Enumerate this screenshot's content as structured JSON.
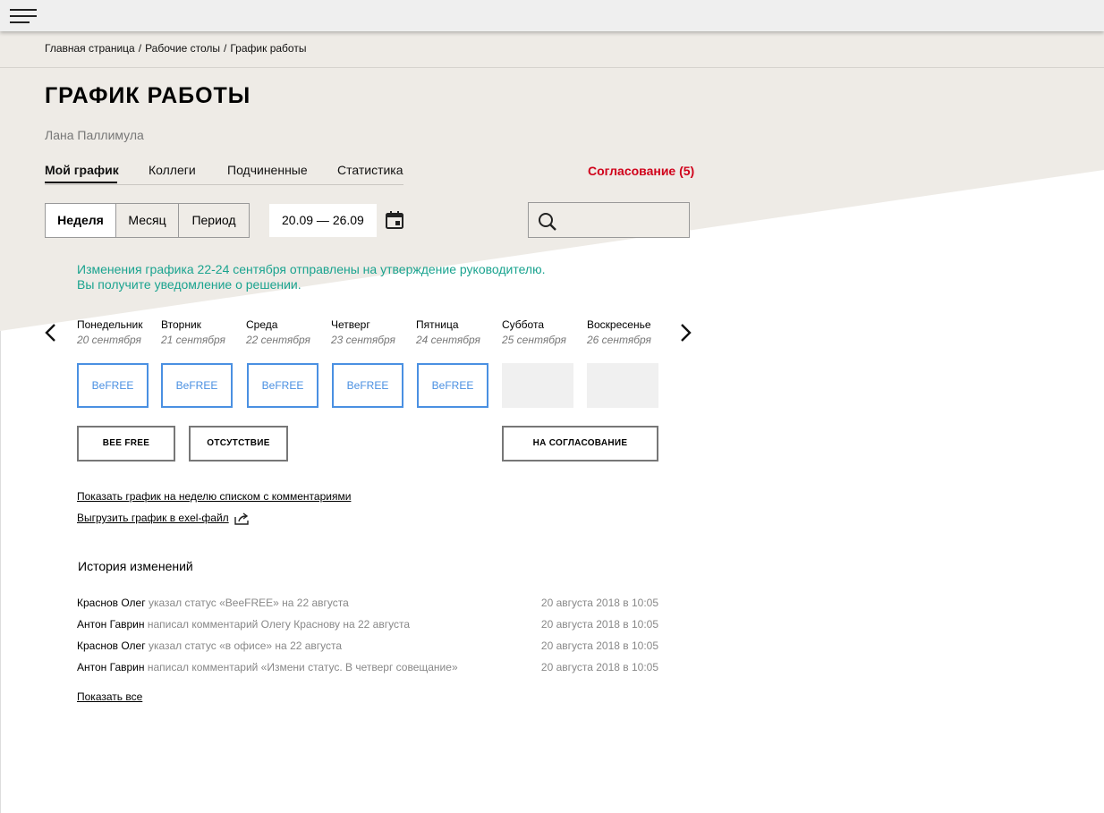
{
  "breadcrumbs": [
    "Главная страница",
    "Рабочие столы",
    "График работы"
  ],
  "breadcrumb_separator": "/",
  "page_title": "ГРАФИК РАБОТЫ",
  "user_name": "Лана Паллимула",
  "tabs": [
    {
      "label": "Мой график",
      "active": true
    },
    {
      "label": "Коллеги",
      "active": false
    },
    {
      "label": "Подчиненные",
      "active": false
    },
    {
      "label": "Статистика",
      "active": false
    }
  ],
  "approval_link": "Согласование (5)",
  "period_buttons": [
    {
      "label": "Неделя",
      "active": true
    },
    {
      "label": "Месяц",
      "active": false
    },
    {
      "label": "Период",
      "active": false
    }
  ],
  "date_range": "20.09 — 26.09",
  "search": {
    "value": "",
    "placeholder": ""
  },
  "notice": {
    "line1": "Изменения графика 22-24 сентября отправлены на утверждение руководителю.",
    "line2": "Вы получите уведомление о решении."
  },
  "days": [
    {
      "name": "Понедельник",
      "date": "20 сентября",
      "status": "BeFREE"
    },
    {
      "name": "Вторник",
      "date": "21 сентября",
      "status": "BeFREE"
    },
    {
      "name": "Среда",
      "date": "22 сентября",
      "status": "BeFREE"
    },
    {
      "name": "Четверг",
      "date": "23 сентября",
      "status": "BeFREE"
    },
    {
      "name": "Пятница",
      "date": "24 сентября",
      "status": "BeFREE"
    },
    {
      "name": "Суббота",
      "date": "25 сентября",
      "status": ""
    },
    {
      "name": "Воскресенье",
      "date": "26 сентября",
      "status": ""
    }
  ],
  "action_buttons": {
    "bee_free": "BEE FREE",
    "absence": "ОТСУТСТВИЕ",
    "to_approval": "НА СОГЛАСОВАНИЕ"
  },
  "links": {
    "show_list": "Показать график на неделю списком с комментариями",
    "export": "Выгрузить график в exel-файл",
    "show_all": "Показать все"
  },
  "history": {
    "title": "История изменений",
    "rows": [
      {
        "who": "Краснов Олег",
        "what": "указал статус «BeeFREE» на 22 августа",
        "when": "20 августа 2018 в 10:05"
      },
      {
        "who": "Антон Гаврин",
        "what": "написал комментарий Олегу Краснову на 22 августа",
        "when": "20 августа 2018 в 10:05"
      },
      {
        "who": "Краснов Олег",
        "what": "указал статус «в офисе» на 22 августа",
        "when": "20 августа 2018 в 10:05"
      },
      {
        "who": "Антон Гаврин",
        "what": "написал комментарий «Измени статус. В четверг совещание»",
        "when": "20 августа 2018 в 10:05"
      }
    ]
  },
  "colors": {
    "accent_red": "#d0021b",
    "notice_green": "#1aa38f",
    "cell_blue": "#4a90e2",
    "bg_beige": "#eeebe6"
  },
  "icons": {
    "menu": "hamburger-icon",
    "calendar": "calendar-icon",
    "search": "search-icon",
    "prev": "chevron-left-icon",
    "next": "chevron-right-icon",
    "share": "share-icon"
  }
}
